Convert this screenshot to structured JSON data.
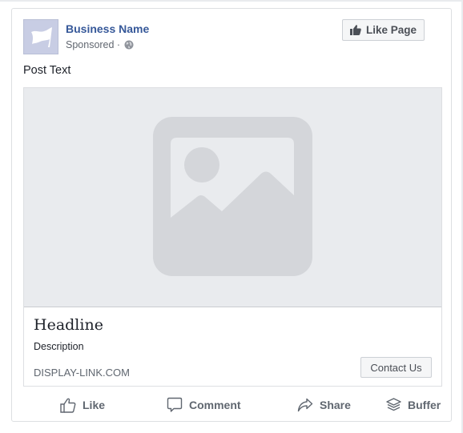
{
  "post": {
    "business_name": "Business Name",
    "sponsored_label": "Sponsored ·",
    "like_page_label": "Like Page",
    "post_text": "Post Text"
  },
  "ad": {
    "headline": "Headline",
    "description": "Description",
    "display_link": "DISPLAY-LINK.COM",
    "cta_label": "Contact Us"
  },
  "actions": [
    {
      "label": "Like",
      "icon": "thumbs-up-outline-icon"
    },
    {
      "label": "Comment",
      "icon": "comment-bubble-icon"
    },
    {
      "label": "Share",
      "icon": "share-arrow-icon"
    },
    {
      "label": "Buffer",
      "icon": "buffer-layers-icon"
    }
  ],
  "colors": {
    "brand_link": "#365899",
    "placeholder_bg": "#e9ebee",
    "placeholder_icon": "#d4d6da",
    "avatar_bg": "#c8cde4"
  }
}
